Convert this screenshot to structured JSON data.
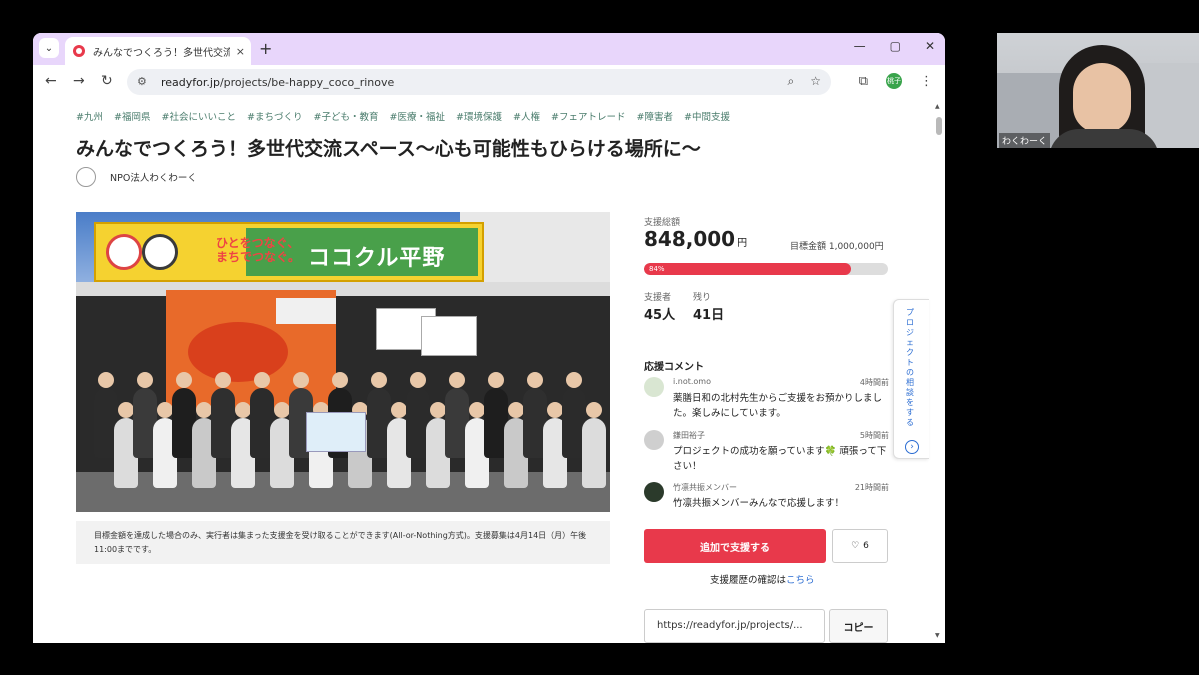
{
  "browser": {
    "tab_title": "みんなでつくろう！多世代交流ス",
    "tab_close": "×",
    "new_tab": "+",
    "window_controls": [
      "—",
      "▢",
      "✕"
    ],
    "url_host": "readyfor.jp",
    "url_path": "/projects/be-happy_coco_rinove",
    "profile_label": "桃子"
  },
  "page": {
    "tags": [
      "#九州",
      "#福岡県",
      "#社会にいいこと",
      "#まちづくり",
      "#子ども・教育",
      "#医療・福祉",
      "#環境保護",
      "#人権",
      "#フェアトレード",
      "#障害者",
      "#中間支援"
    ],
    "title": "みんなでつくろう！多世代交流スペース〜心も可能性もひらける場所に〜",
    "org_name": "NPO法人わくわーく",
    "photo": {
      "sign_text": "ココクル平野",
      "sign_sub": "ひとをつなぐ、まちでつなぐ。"
    },
    "notice": "目標金額を達成した場合のみ、実行者は集まった支援金を受け取ることができます(All-or-Nothing方式)。支援募集は4月14日（月）午後11:00までです。"
  },
  "funding": {
    "total_label": "支援総額",
    "total": "848,000",
    "currency": "円",
    "goal": "目標金額 1,000,000円",
    "progress_label": "84%",
    "progress": 0.848,
    "supporters_label": "支援者",
    "supporters": "45人",
    "remaining_label": "残り",
    "remaining": "41日"
  },
  "comments": {
    "heading": "応援コメント",
    "items": [
      {
        "name": "i.not.omo",
        "time": "4時間前",
        "text": "薬膳日和の北村先生からご支援をお預かりしました。楽しみにしています。",
        "avatar_color": "#d9e6d2"
      },
      {
        "name": "鎌田裕子",
        "time": "5時間前",
        "text": "プロジェクトの成功を願っています🍀 頑張って下さい！",
        "avatar_color": "#cfcfcf"
      },
      {
        "name": "竹凛共振メンバー",
        "time": "21時間前",
        "text": "竹凛共振メンバーみんなで応援します！",
        "avatar_color": "#2b3a2b"
      }
    ]
  },
  "actions": {
    "support_button": "追加で支援する",
    "favorite_count": "6",
    "history_text": "支援履歴の確認は",
    "history_link": "こちら",
    "share_url": "https://readyfor.jp/projects/...",
    "copy_button": "コピー"
  },
  "side_tab": {
    "label": "プロジェクトの相談をする",
    "arrow": "›"
  },
  "video": {
    "participant_name": "わくわーく"
  },
  "colors": {
    "accent": "#e8394b",
    "tab_bar": "#e8d6fb",
    "tag_text": "#4a7c6c",
    "link": "#2a6cd2"
  }
}
